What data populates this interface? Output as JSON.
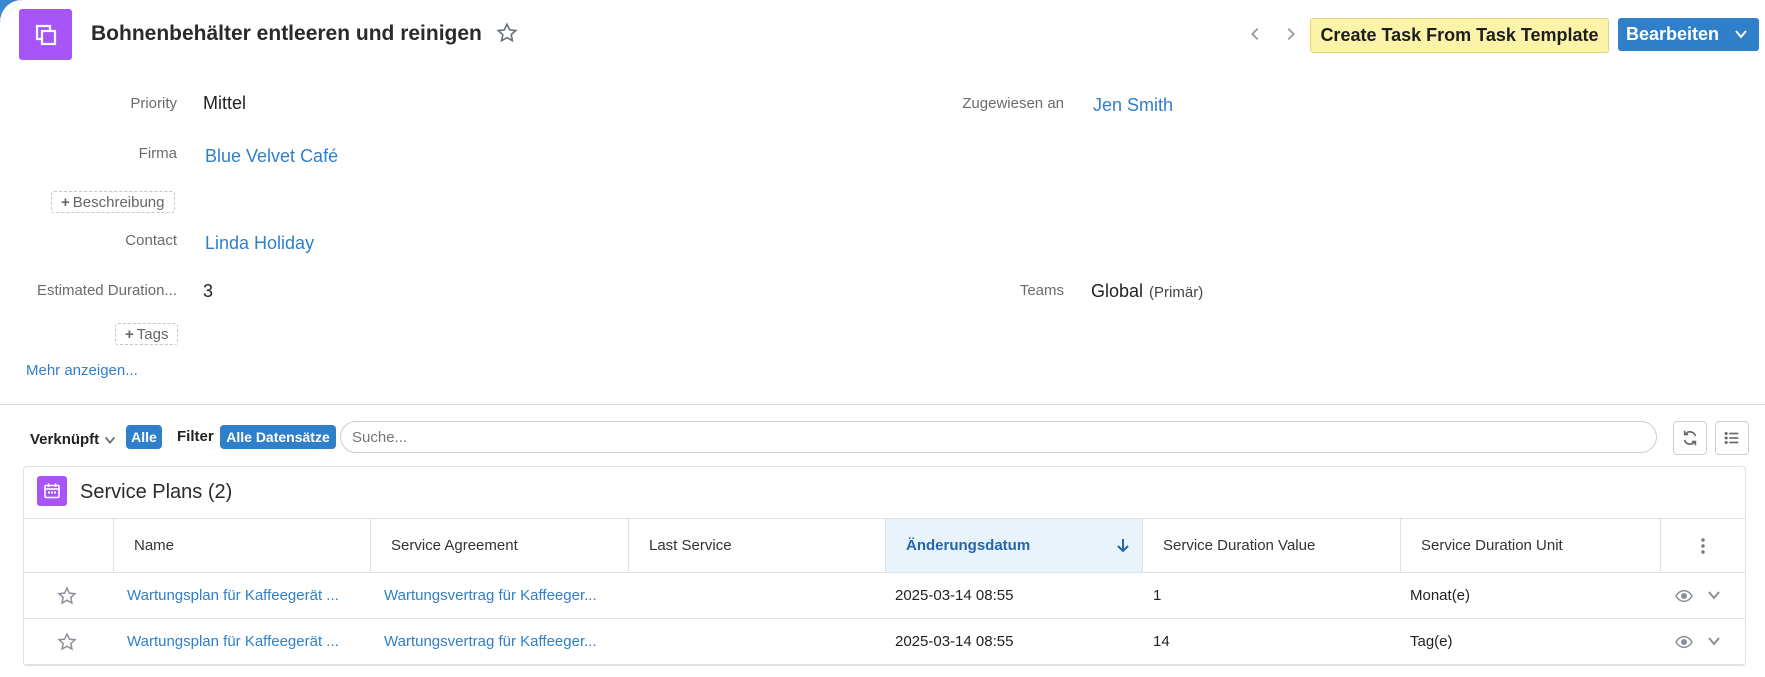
{
  "header": {
    "title": "Bohnenbehälter entleeren und reinigen",
    "template_button": "Create Task From Task Template",
    "edit_button": "Bearbeiten"
  },
  "fields": {
    "priority": {
      "label": "Priority",
      "value": "Mittel"
    },
    "assigned": {
      "label": "Zugewiesen an",
      "value": "Jen Smith"
    },
    "company": {
      "label": "Firma",
      "value": "Blue Velvet Café"
    },
    "description_add": "Beschreibung",
    "contact": {
      "label": "Contact",
      "value": "Linda Holiday"
    },
    "duration": {
      "label": "Estimated Duration...",
      "value": "3"
    },
    "teams": {
      "label": "Teams",
      "value": "Global",
      "tag": "(Primär)"
    },
    "tags_add": "Tags",
    "show_more": "Mehr anzeigen..."
  },
  "filterbar": {
    "linked_label": "Verknüpft",
    "all_pill": "Alle",
    "filter_label": "Filter",
    "all_records_pill": "Alle Datensätze",
    "search_placeholder": "Suche..."
  },
  "panel": {
    "title": "Service Plans (2)",
    "columns": [
      "Name",
      "Service Agreement",
      "Last Service",
      "Änderungsdatum",
      "Service Duration Value",
      "Service Duration Unit"
    ],
    "rows": [
      {
        "name": "Wartungsplan für Kaffeegerät ...",
        "agreement": "Wartungsvertrag für Kaffeeger...",
        "last_service": "",
        "modified": "2025-03-14 08:55",
        "duration_value": "1",
        "duration_unit": "Monat(e)"
      },
      {
        "name": "Wartungsplan für Kaffeegerät ...",
        "agreement": "Wartungsvertrag für Kaffeeger...",
        "last_service": "",
        "modified": "2025-03-14 08:55",
        "duration_value": "14",
        "duration_unit": "Tag(e)"
      }
    ]
  },
  "colors": {
    "accent": "#2f7fc9",
    "entity": "#a855f7",
    "template_bg": "#fbf3a8",
    "sorted_header_bg": "#e8f3fc"
  },
  "icons": [
    "entity-icon",
    "star-icon",
    "chevron-left-icon",
    "chevron-right-icon",
    "chevron-down-icon",
    "calendar-icon",
    "refresh-icon",
    "list-icon",
    "arrow-down-icon",
    "kebab-icon",
    "eye-icon"
  ]
}
